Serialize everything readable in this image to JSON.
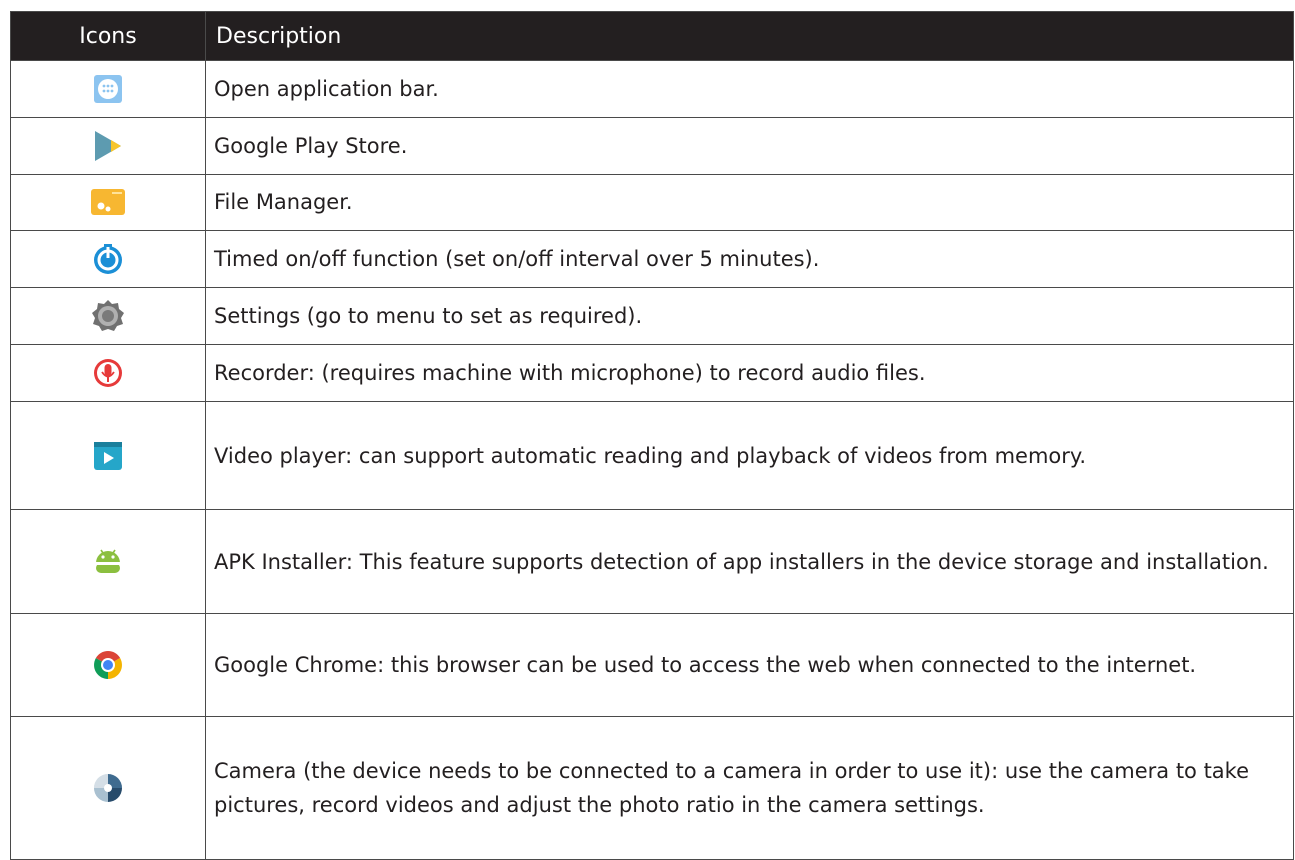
{
  "table": {
    "headers": {
      "icons": "Icons",
      "description": "Description"
    },
    "rows": [
      {
        "icon": "app-drawer-icon",
        "description": "Open application bar."
      },
      {
        "icon": "play-store-icon",
        "description": "Google Play Store."
      },
      {
        "icon": "file-manager-icon",
        "description": "File Manager."
      },
      {
        "icon": "timer-power-icon",
        "description": "Timed on/off function (set on/off interval over 5 minutes)."
      },
      {
        "icon": "settings-gear-icon",
        "description": "Settings (go to menu to set as required)."
      },
      {
        "icon": "microphone-recorder-icon",
        "description": "Recorder: (requires machine with microphone) to record audio files."
      },
      {
        "icon": "video-player-icon",
        "description": "Video player: can support automatic reading and playback of videos from memory."
      },
      {
        "icon": "android-apk-icon",
        "description": "APK Installer: This feature supports detection of app installers in the device storage and installation."
      },
      {
        "icon": "chrome-icon",
        "description": "Google Chrome: this browser can be used to access the web when connected to the internet."
      },
      {
        "icon": "camera-aperture-icon",
        "description": "Camera (the device needs to be connected to a camera in order to use it): use the camera to take pictures, record videos and adjust the photo ratio in the camera settings."
      }
    ]
  }
}
